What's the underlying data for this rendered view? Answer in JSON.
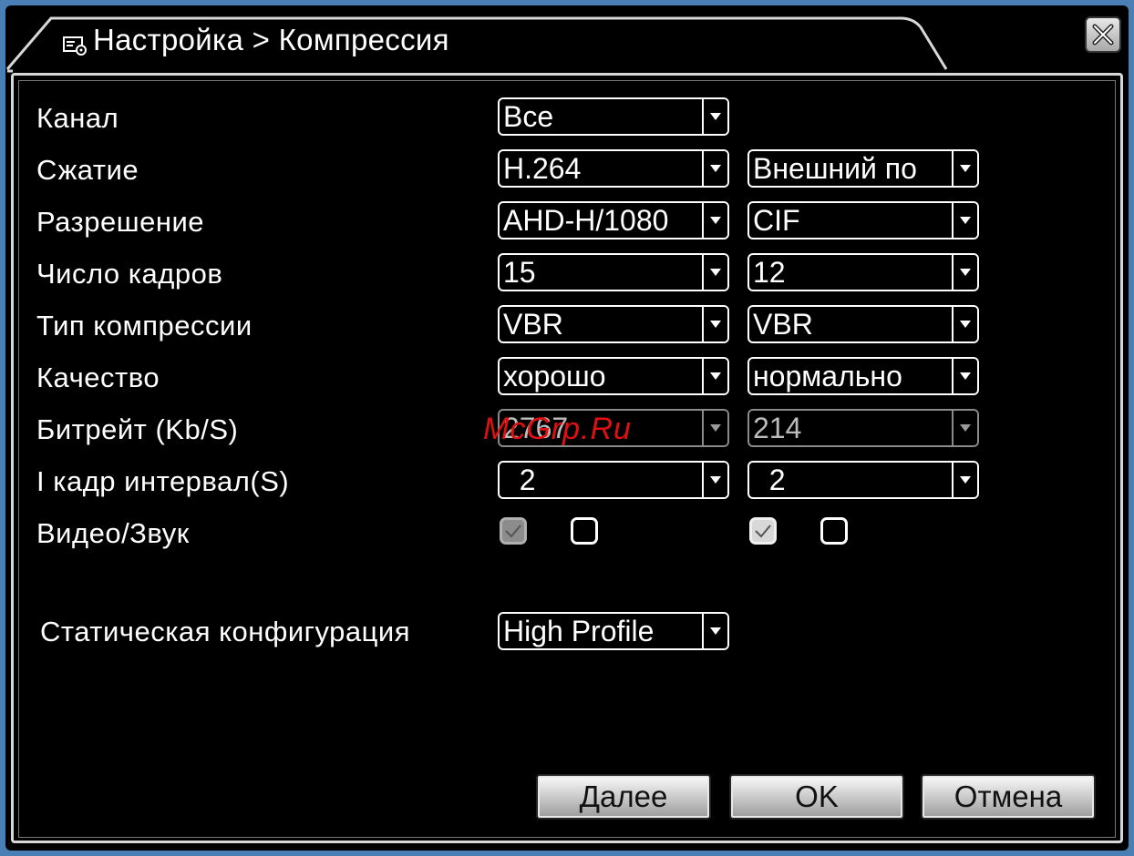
{
  "window": {
    "title": "Настройка > Компрессия"
  },
  "fields": {
    "channel": {
      "label": "Канал",
      "value": "Все"
    },
    "compression": {
      "label": "Сжатие",
      "main": "H.264",
      "extra": "Внешний по"
    },
    "resolution": {
      "label": "Разрешение",
      "main": "AHD-H/1080",
      "extra": "CIF"
    },
    "frame_rate": {
      "label": "Число кадров",
      "main": "15",
      "extra": "12"
    },
    "bitrate_type": {
      "label": "Тип компрессии",
      "main": "VBR",
      "extra": "VBR"
    },
    "quality": {
      "label": "Качество",
      "main": "хорошо",
      "extra": "нормально"
    },
    "bitrate": {
      "label": "Битрейт (Kb/S)",
      "main": "2767",
      "extra": "214"
    },
    "i_frame_interval": {
      "label": "I кадр интервал(S)",
      "main": "  2",
      "extra": "  2"
    },
    "video_audio": {
      "label": "Видео/Звук",
      "main_video_checked": true,
      "main_audio_checked": false,
      "extra_video_checked": true,
      "extra_audio_checked": false
    },
    "static_config": {
      "label": "Статическая конфигурация",
      "value": "High Profile"
    }
  },
  "watermark": "McGrp.Ru",
  "buttons": {
    "next": "Далее",
    "ok": "OK",
    "cancel": "Отмена"
  },
  "colors": {
    "background": "#000000",
    "border": "#4a7fb5",
    "text": "#ffffff",
    "disabled_text": "#bcbcbc",
    "watermark": "#e01010"
  },
  "icons": {
    "title": "settings-window-icon",
    "close": "close-x-icon",
    "dropdown": "triangle-down-icon",
    "check": "checkmark-icon"
  }
}
